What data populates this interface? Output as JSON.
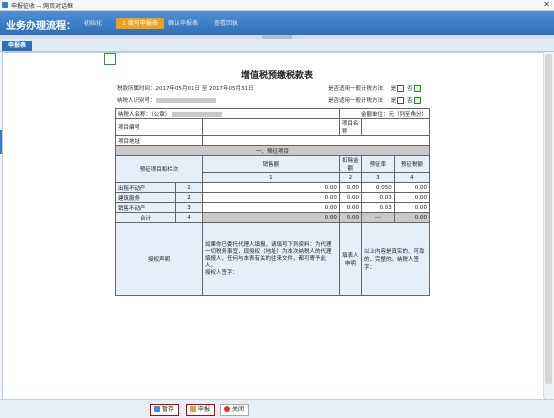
{
  "window": {
    "title": "申报征收 -- 网页对话框",
    "close_glyph": "✕"
  },
  "flow": {
    "title": "业务办理流程：",
    "steps": [
      {
        "num": "",
        "label": "初始化"
      },
      {
        "num": "1",
        "label": "填写申报表"
      },
      {
        "num": "",
        "label": "确认申报表"
      },
      {
        "num": "",
        "label": "查看回执"
      }
    ],
    "active_step": 1
  },
  "tab": {
    "label": "申报表"
  },
  "form": {
    "title": "增值税预缴税款表",
    "period_label": "税款所属时间：2017年05月01日 至 2017年05月31日",
    "taxpayer_id_label": "纳税人识别号：",
    "q_general_taxpayer": "是否适用一般计税方法",
    "q_general_method": "是否适用一般计税方法",
    "yes": "是",
    "no": "否",
    "taxpayer_name_label": "纳税人名称：（公章）",
    "unit_label": "金额单位：元（列至角分）",
    "project_no_label": "项目编号",
    "project_name_label": "项目名称",
    "project_addr_label": "项目地址",
    "section_title": "一、预征项目",
    "col_headers": [
      "预征项目和栏次",
      "销售额",
      "扣除金额",
      "预征率",
      "预征税额"
    ],
    "col_nums": [
      "1",
      "2",
      "3",
      "4"
    ],
    "rows": [
      {
        "name": "出租不动产",
        "no": "1",
        "sales": "0.00",
        "deduct": "0.00",
        "rate": "0.050",
        "tax": "0.00"
      },
      {
        "name": "建筑服务",
        "no": "2",
        "sales": "0.00",
        "deduct": "0.00",
        "rate": "0.03",
        "tax": "0.00"
      },
      {
        "name": "销售不动产",
        "no": "3",
        "sales": "0.00",
        "deduct": "0.00",
        "rate": "0.03",
        "tax": "0.00"
      },
      {
        "name": "合计",
        "no": "4",
        "sales": "0.00",
        "deduct": "0.00",
        "rate": "---",
        "tax": "0.00"
      }
    ],
    "authorization_label": "授权声明",
    "authorization_text": "如果你已委托代理人填报，请填写下列资料：为代理一切税务事宜，现授权（地址）为本次纳税人的代理填报人，任何与本表有关的往来文件，都可寄予此人。",
    "authorized_sign": "授权人签字：",
    "filler_sign": "填表人申明",
    "declaration_text": "以上内容是真实的、可靠的、完整的。纳税人签字："
  },
  "buttons": {
    "save": "暂存",
    "declare": "申报",
    "close": "关闭"
  },
  "colors": {
    "accent": "#2f6fb8",
    "active_step": "#f0a11b",
    "highlight_border": "#cc0000"
  }
}
